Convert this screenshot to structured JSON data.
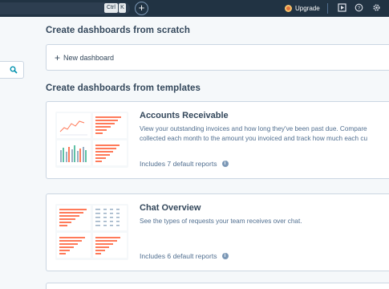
{
  "topbar": {
    "kbd_ctrl": "Ctrl",
    "kbd_k": "K",
    "add_tab": "+",
    "upgrade_label": "Upgrade"
  },
  "sections": {
    "scratch_title": "Create dashboards from scratch",
    "new_dashboard_label": "New dashboard",
    "new_dashboard_icon": "+",
    "templates_title": "Create dashboards from templates"
  },
  "templates": [
    {
      "title": "Accounts Receivable",
      "description_line1": "View your outstanding invoices and how long they've been past due. Compare",
      "description_line2": "collected each month to the amount you invoiced and track how much each cu",
      "reports": "Includes 7 default reports"
    },
    {
      "title": "Chat Overview",
      "description_line1": "See the types of requests your team receives over chat.",
      "description_line2": "",
      "reports": "Includes 6 default reports"
    }
  ],
  "colors": {
    "topbar": "#213343",
    "accent": "#ff7a59",
    "bars_alt": "#99afc4",
    "bars_green": "#5ec1a5",
    "text": "#33475b"
  }
}
